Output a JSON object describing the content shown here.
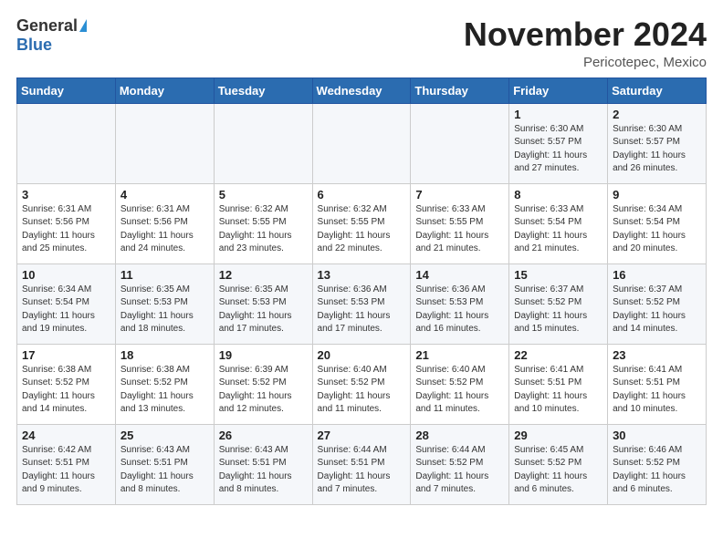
{
  "logo": {
    "general": "General",
    "blue": "Blue"
  },
  "title": "November 2024",
  "subtitle": "Pericotepec, Mexico",
  "days_of_week": [
    "Sunday",
    "Monday",
    "Tuesday",
    "Wednesday",
    "Thursday",
    "Friday",
    "Saturday"
  ],
  "weeks": [
    [
      {
        "day": "",
        "info": ""
      },
      {
        "day": "",
        "info": ""
      },
      {
        "day": "",
        "info": ""
      },
      {
        "day": "",
        "info": ""
      },
      {
        "day": "",
        "info": ""
      },
      {
        "day": "1",
        "info": "Sunrise: 6:30 AM\nSunset: 5:57 PM\nDaylight: 11 hours and 27 minutes."
      },
      {
        "day": "2",
        "info": "Sunrise: 6:30 AM\nSunset: 5:57 PM\nDaylight: 11 hours and 26 minutes."
      }
    ],
    [
      {
        "day": "3",
        "info": "Sunrise: 6:31 AM\nSunset: 5:56 PM\nDaylight: 11 hours and 25 minutes."
      },
      {
        "day": "4",
        "info": "Sunrise: 6:31 AM\nSunset: 5:56 PM\nDaylight: 11 hours and 24 minutes."
      },
      {
        "day": "5",
        "info": "Sunrise: 6:32 AM\nSunset: 5:55 PM\nDaylight: 11 hours and 23 minutes."
      },
      {
        "day": "6",
        "info": "Sunrise: 6:32 AM\nSunset: 5:55 PM\nDaylight: 11 hours and 22 minutes."
      },
      {
        "day": "7",
        "info": "Sunrise: 6:33 AM\nSunset: 5:55 PM\nDaylight: 11 hours and 21 minutes."
      },
      {
        "day": "8",
        "info": "Sunrise: 6:33 AM\nSunset: 5:54 PM\nDaylight: 11 hours and 21 minutes."
      },
      {
        "day": "9",
        "info": "Sunrise: 6:34 AM\nSunset: 5:54 PM\nDaylight: 11 hours and 20 minutes."
      }
    ],
    [
      {
        "day": "10",
        "info": "Sunrise: 6:34 AM\nSunset: 5:54 PM\nDaylight: 11 hours and 19 minutes."
      },
      {
        "day": "11",
        "info": "Sunrise: 6:35 AM\nSunset: 5:53 PM\nDaylight: 11 hours and 18 minutes."
      },
      {
        "day": "12",
        "info": "Sunrise: 6:35 AM\nSunset: 5:53 PM\nDaylight: 11 hours and 17 minutes."
      },
      {
        "day": "13",
        "info": "Sunrise: 6:36 AM\nSunset: 5:53 PM\nDaylight: 11 hours and 17 minutes."
      },
      {
        "day": "14",
        "info": "Sunrise: 6:36 AM\nSunset: 5:53 PM\nDaylight: 11 hours and 16 minutes."
      },
      {
        "day": "15",
        "info": "Sunrise: 6:37 AM\nSunset: 5:52 PM\nDaylight: 11 hours and 15 minutes."
      },
      {
        "day": "16",
        "info": "Sunrise: 6:37 AM\nSunset: 5:52 PM\nDaylight: 11 hours and 14 minutes."
      }
    ],
    [
      {
        "day": "17",
        "info": "Sunrise: 6:38 AM\nSunset: 5:52 PM\nDaylight: 11 hours and 14 minutes."
      },
      {
        "day": "18",
        "info": "Sunrise: 6:38 AM\nSunset: 5:52 PM\nDaylight: 11 hours and 13 minutes."
      },
      {
        "day": "19",
        "info": "Sunrise: 6:39 AM\nSunset: 5:52 PM\nDaylight: 11 hours and 12 minutes."
      },
      {
        "day": "20",
        "info": "Sunrise: 6:40 AM\nSunset: 5:52 PM\nDaylight: 11 hours and 11 minutes."
      },
      {
        "day": "21",
        "info": "Sunrise: 6:40 AM\nSunset: 5:52 PM\nDaylight: 11 hours and 11 minutes."
      },
      {
        "day": "22",
        "info": "Sunrise: 6:41 AM\nSunset: 5:51 PM\nDaylight: 11 hours and 10 minutes."
      },
      {
        "day": "23",
        "info": "Sunrise: 6:41 AM\nSunset: 5:51 PM\nDaylight: 11 hours and 10 minutes."
      }
    ],
    [
      {
        "day": "24",
        "info": "Sunrise: 6:42 AM\nSunset: 5:51 PM\nDaylight: 11 hours and 9 minutes."
      },
      {
        "day": "25",
        "info": "Sunrise: 6:43 AM\nSunset: 5:51 PM\nDaylight: 11 hours and 8 minutes."
      },
      {
        "day": "26",
        "info": "Sunrise: 6:43 AM\nSunset: 5:51 PM\nDaylight: 11 hours and 8 minutes."
      },
      {
        "day": "27",
        "info": "Sunrise: 6:44 AM\nSunset: 5:51 PM\nDaylight: 11 hours and 7 minutes."
      },
      {
        "day": "28",
        "info": "Sunrise: 6:44 AM\nSunset: 5:52 PM\nDaylight: 11 hours and 7 minutes."
      },
      {
        "day": "29",
        "info": "Sunrise: 6:45 AM\nSunset: 5:52 PM\nDaylight: 11 hours and 6 minutes."
      },
      {
        "day": "30",
        "info": "Sunrise: 6:46 AM\nSunset: 5:52 PM\nDaylight: 11 hours and 6 minutes."
      }
    ]
  ]
}
